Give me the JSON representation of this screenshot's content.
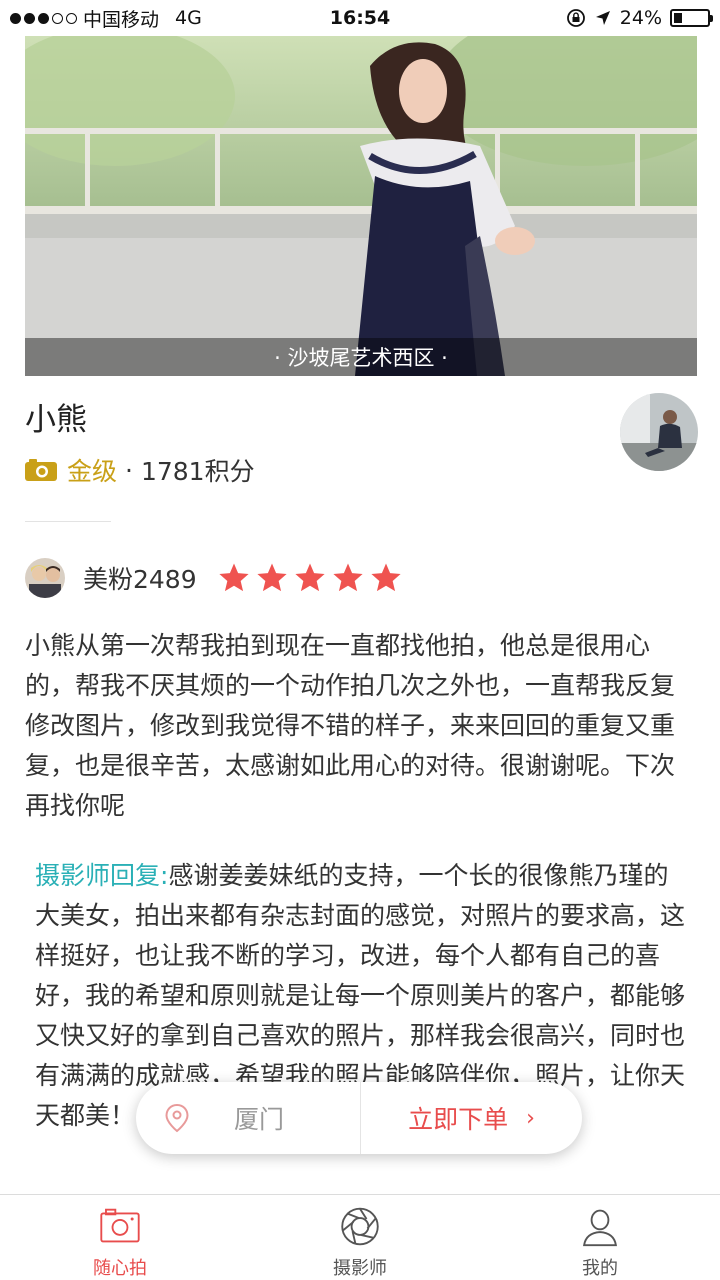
{
  "status_bar": {
    "carrier": "中国移动",
    "network": "4G",
    "time": "16:54",
    "battery": "24%",
    "battery_level": 0.24
  },
  "hero": {
    "location_caption": "· 沙坡尾艺术西区 ·"
  },
  "photographer": {
    "name": "小熊",
    "level": "金级",
    "separator": "·",
    "points": "1781积分"
  },
  "review": {
    "reviewer_name": "美粉2489",
    "rating": 5,
    "rating_max": 5,
    "text": "小熊从第一次帮我拍到现在一直都找他拍，他总是很用心的，帮我不厌其烦的一个动作拍几次之外也，一直帮我反复修改图片，修改到我觉得不错的样子，来来回回的重复又重复，也是很辛苦，太感谢如此用心的对待。很谢谢呢。下次再找你呢",
    "reply_label": "摄影师回复:",
    "reply_text": "感谢姜姜妹纸的支持，一个长的很像熊乃瑾的大美女，拍出来都有杂志封面的感觉，对照片的要求高，这样挺好，也让我不断的学习，改进，每个人都有自己的喜好，我的希望和原则就是让每一个原则美片的客户，都能够又快又好的拿到自己喜欢的照片，那样我会很高兴，同时也有满满的成就感，希望我的照片能够陪伴你，照片，让你天天都美！"
  },
  "order_bar": {
    "city": "厦门",
    "order_button": "立即下单",
    "chevron": "›"
  },
  "tabs": [
    {
      "label": "随心拍",
      "icon": "camera-icon",
      "active": true
    },
    {
      "label": "摄影师",
      "icon": "aperture-icon",
      "active": false
    },
    {
      "label": "我的",
      "icon": "person-icon",
      "active": false
    }
  ],
  "colors": {
    "accent_red": "#e84c4c",
    "gold": "#c9a018",
    "reply_teal": "#2ab0b6",
    "star_red": "#ef5350"
  }
}
